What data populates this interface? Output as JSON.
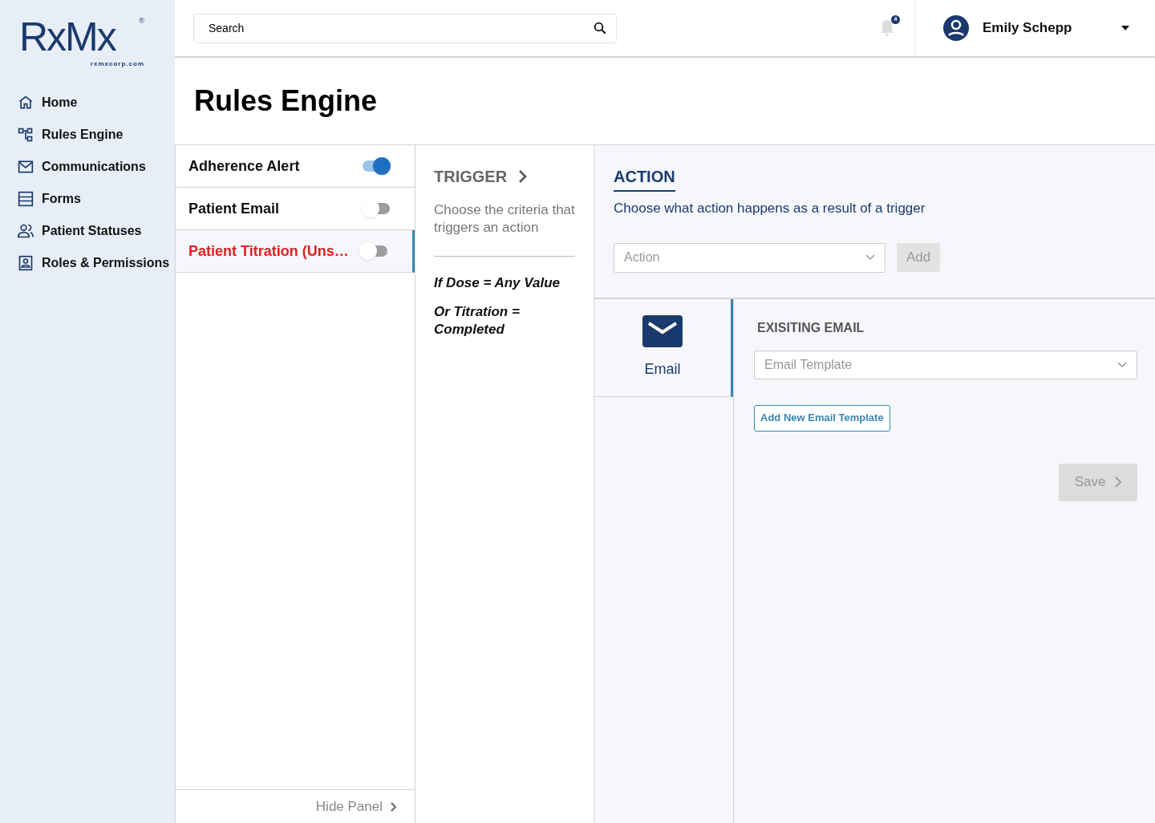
{
  "logo": {
    "mark": "RxMx",
    "registered": "®",
    "domain": "rxmxcorp.com"
  },
  "nav": [
    {
      "label": "Home"
    },
    {
      "label": "Rules Engine"
    },
    {
      "label": "Communications"
    },
    {
      "label": "Forms"
    },
    {
      "label": "Patient Statuses"
    },
    {
      "label": "Roles & Permissions"
    }
  ],
  "search": {
    "placeholder": "Search"
  },
  "notifications": {
    "count": "4"
  },
  "user": {
    "name": "Emily Schepp"
  },
  "page_title": "Rules Engine",
  "rules": [
    {
      "name": "Adherence Alert",
      "on": true,
      "selected": false
    },
    {
      "name": "Patient Email",
      "on": false,
      "selected": false
    },
    {
      "name": "Patient Titration (Uns…",
      "on": false,
      "selected": true
    }
  ],
  "hide_panel": "Hide Panel",
  "trigger": {
    "heading": "TRIGGER",
    "description": "Choose the criteria that triggers an action",
    "conditions": [
      "If Dose = Any Value",
      "Or Titration = Completed"
    ]
  },
  "action": {
    "heading": "ACTION",
    "description": "Choose what action happens as a result of a trigger",
    "select_placeholder": "Action",
    "add_button": "Add"
  },
  "action_types": [
    {
      "label": "Email",
      "selected": true
    }
  ],
  "email": {
    "section_label": "EXISITING EMAIL",
    "template_placeholder": "Email Template",
    "new_template_button": "Add New Email Template",
    "save_button": "Save"
  }
}
